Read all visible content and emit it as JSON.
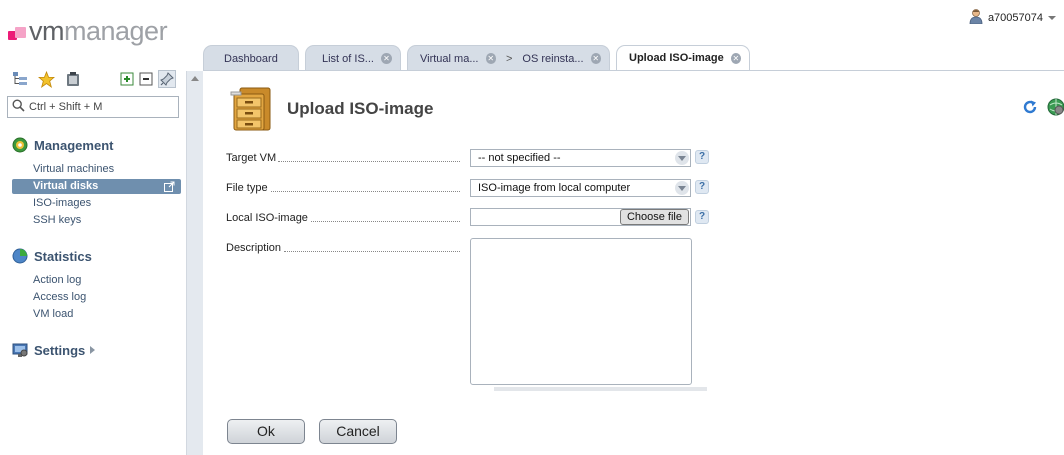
{
  "logo": {
    "part1": "vm",
    "part2": "manager"
  },
  "user": {
    "name": "a70057074"
  },
  "tabs": [
    {
      "label": "Dashboard"
    },
    {
      "label": "List of IS..."
    },
    {
      "label": "Virtual ma...",
      "next": "OS reinsta..."
    },
    {
      "label": "Upload ISO-image"
    }
  ],
  "sidebar": {
    "search_placeholder": "Ctrl + Shift + M",
    "sections": [
      {
        "title": "Management",
        "items": [
          "Virtual machines",
          "Virtual disks",
          "ISO-images",
          "SSH keys"
        ]
      },
      {
        "title": "Statistics",
        "items": [
          "Action log",
          "Access log",
          "VM load"
        ]
      },
      {
        "title": "Settings",
        "items": []
      }
    ],
    "selected": "Virtual disks"
  },
  "page": {
    "title": "Upload ISO-image"
  },
  "form": {
    "target_vm": {
      "label": "Target VM",
      "value": "-- not specified --"
    },
    "file_type": {
      "label": "File type",
      "value": "ISO-image from local computer"
    },
    "local_iso": {
      "label": "Local ISO-image",
      "button": "Choose file"
    },
    "description": {
      "label": "Description",
      "value": ""
    },
    "help_glyph": "?"
  },
  "buttons": {
    "ok": "Ok",
    "cancel": "Cancel"
  },
  "colors": {
    "accent": "#6f8fae",
    "nav_text": "#3c5470",
    "logo_pink": "#ec1c78"
  }
}
